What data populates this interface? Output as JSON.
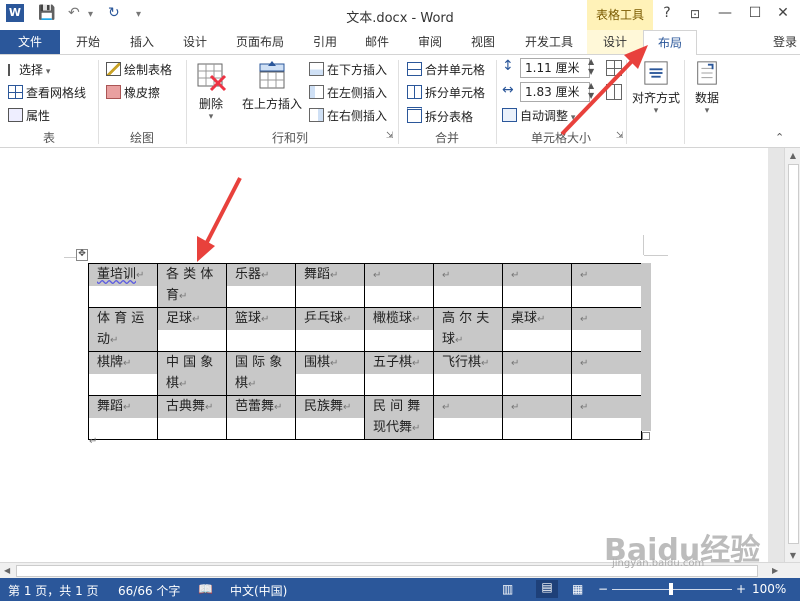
{
  "titlebar": {
    "title": "文本.docx - Word",
    "context_group": "表格工具",
    "help": "?",
    "window_icons": [
      "restore-ribbon-icon",
      "minimize-icon",
      "maximize-icon",
      "close-icon"
    ]
  },
  "tabs": {
    "file": "文件",
    "items": [
      "开始",
      "插入",
      "设计",
      "页面布局",
      "引用",
      "邮件",
      "审阅",
      "视图",
      "开发工具"
    ],
    "context": [
      "设计",
      "布局"
    ],
    "active": "布局",
    "login": "登录"
  },
  "ribbon": {
    "table": {
      "select": "选择",
      "gridlines": "查看网格线",
      "properties": "属性",
      "label": "表"
    },
    "draw": {
      "draw_table": "绘制表格",
      "eraser": "橡皮擦",
      "label": "绘图"
    },
    "rows_cols": {
      "delete": "删除",
      "insert_above": "在上方插入",
      "insert_below": "在下方插入",
      "insert_left": "在左侧插入",
      "insert_right": "在右侧插入",
      "label": "行和列"
    },
    "merge": {
      "merge_cells": "合并单元格",
      "split_cells": "拆分单元格",
      "split_table": "拆分表格",
      "label": "合并"
    },
    "cell_size": {
      "height": "1.11 厘米",
      "width": "1.83 厘米",
      "autofit": "自动调整",
      "label": "单元格大小"
    },
    "alignment": {
      "label": "对齐方式"
    },
    "data": {
      "label": "数据"
    }
  },
  "table": {
    "rows": [
      [
        "董培训",
        "各 类 体 育",
        "乐器",
        "舞蹈",
        "",
        "",
        "",
        ""
      ],
      [
        "体 育 运 动",
        "足球",
        "篮球",
        "乒乓球",
        "橄榄球",
        "高 尔 夫 球",
        "桌球",
        ""
      ],
      [
        "棋牌",
        "中 国 象 棋",
        "国 际 象 棋",
        "围棋",
        "五子棋",
        "飞行棋",
        "",
        ""
      ],
      [
        "舞蹈",
        "古典舞",
        "芭蕾舞",
        "民族舞",
        "民 间 舞 现代舞",
        "",
        "",
        ""
      ]
    ],
    "paragraph_mark": "↵"
  },
  "statusbar": {
    "page": "第 1 页，共 1 页",
    "words": "66/66 个字",
    "language": "中文(中国)",
    "zoom": "100%",
    "zoom_minus": "−",
    "zoom_plus": "+"
  },
  "watermark": {
    "brand": "Baidu经验",
    "url": "jingyan.baidu.com"
  },
  "colors": {
    "accent": "#2b579a",
    "context_tab": "#fff2b8",
    "cell_shade": "#c8c8c8",
    "arrow": "#e8413c"
  }
}
